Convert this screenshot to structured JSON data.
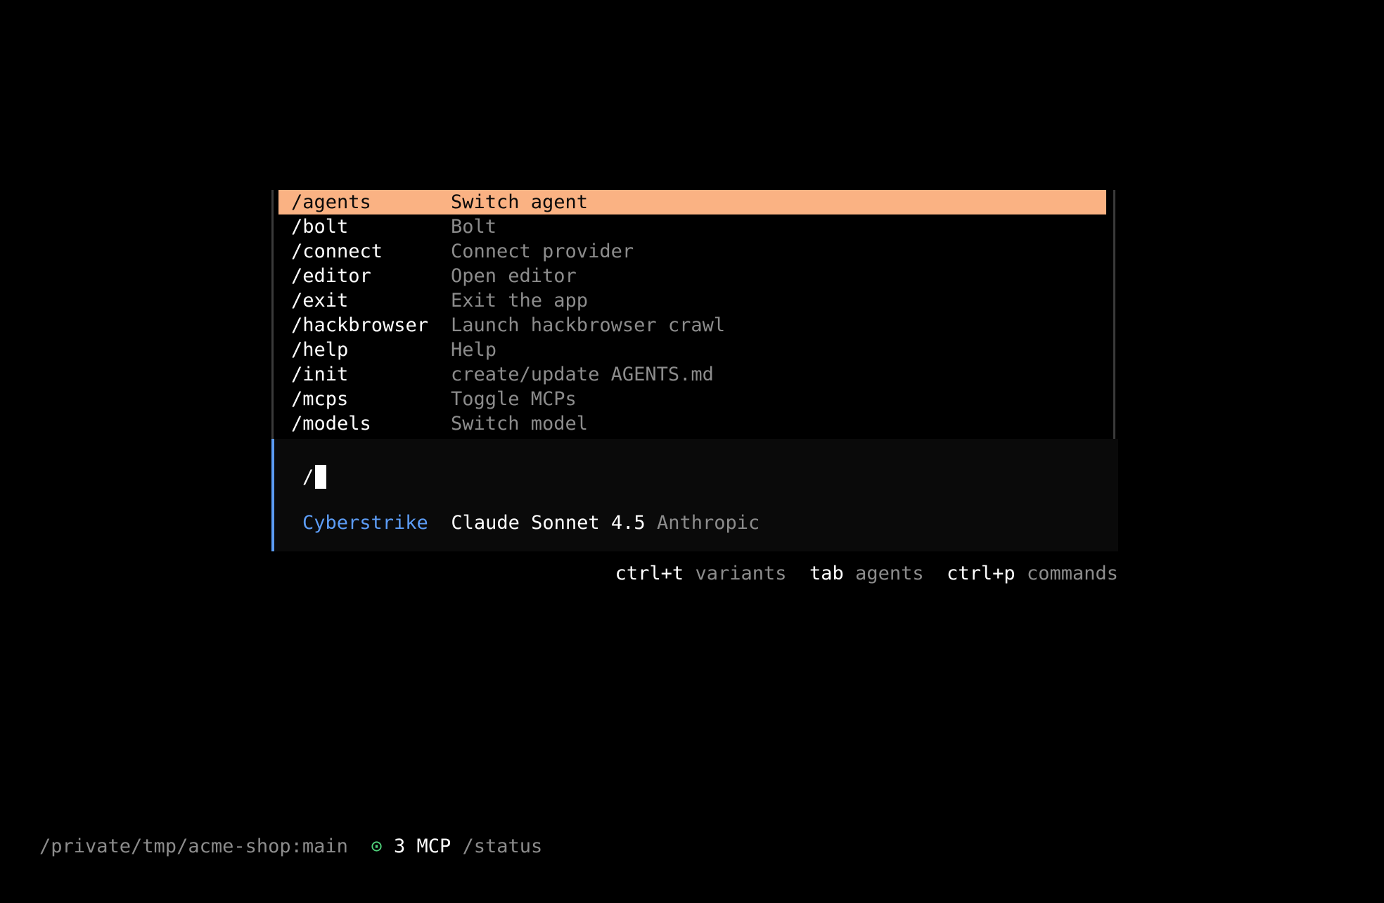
{
  "commands": [
    {
      "name": "/agents",
      "description": "Switch agent",
      "selected": true
    },
    {
      "name": "/bolt",
      "description": "Bolt",
      "selected": false
    },
    {
      "name": "/connect",
      "description": "Connect provider",
      "selected": false
    },
    {
      "name": "/editor",
      "description": "Open editor",
      "selected": false
    },
    {
      "name": "/exit",
      "description": "Exit the app",
      "selected": false
    },
    {
      "name": "/hackbrowser",
      "description": "Launch hackbrowser crawl",
      "selected": false
    },
    {
      "name": "/help",
      "description": "Help",
      "selected": false
    },
    {
      "name": "/init",
      "description": "create/update AGENTS.md",
      "selected": false
    },
    {
      "name": "/mcps",
      "description": "Toggle MCPs",
      "selected": false
    },
    {
      "name": "/models",
      "description": "Switch model",
      "selected": false
    }
  ],
  "prompt": {
    "value": "/",
    "agent": "Cyberstrike",
    "model": "Claude Sonnet 4.5",
    "provider": "Anthropic"
  },
  "hints": [
    {
      "key": "ctrl+t",
      "label": "variants"
    },
    {
      "key": "tab",
      "label": "agents"
    },
    {
      "key": "ctrl+p",
      "label": "commands"
    }
  ],
  "statusbar": {
    "path": "/private/tmp/acme-shop:main",
    "mcp_icon": "⊙",
    "mcp_count": "3 MCP",
    "status": "/status"
  },
  "colors": {
    "selection": "#fab283",
    "accent": "#5c9cf5",
    "muted": "#8c8c8c",
    "mcp_ok": "#4fd17a"
  }
}
